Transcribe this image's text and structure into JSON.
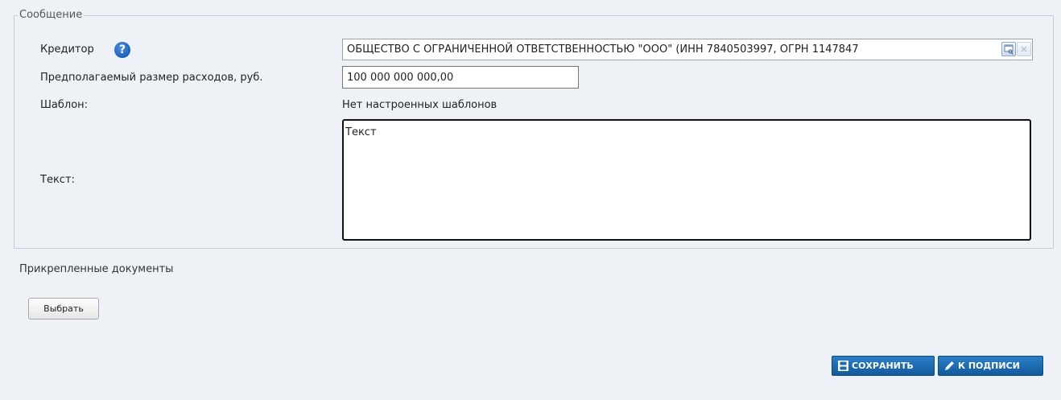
{
  "form": {
    "legend": "Сообщение",
    "creditor_label": "Кредитор",
    "creditor_value": "ОБЩЕСТВО С ОГРАНИЧЕННОЙ ОТВЕТСТВЕННОСТЬЮ \"ООО\" (ИНН 7840503997, ОГРН 1147847",
    "expenses_label": "Предполагаемый размер расходов, руб.",
    "expenses_value": "100 000 000 000,00",
    "template_label": "Шаблон:",
    "template_value": "Нет настроенных шаблонов",
    "text_label": "Текст:",
    "text_value": "Текст"
  },
  "attachments": {
    "label": "Прикрепленные документы",
    "choose_label": "Выбрать"
  },
  "actions": {
    "save_label": "СОХРАНИТЬ",
    "sign_label": "К ПОДПИСИ"
  },
  "icons": {
    "help": "help-icon",
    "lookup": "lookup-icon",
    "clear": "clear-icon",
    "save": "floppy-disk-icon",
    "sign": "pen-icon"
  },
  "colors": {
    "background": "#eef2f7",
    "accent": "#1a6bb5",
    "help_icon": "#1c5fc0"
  }
}
